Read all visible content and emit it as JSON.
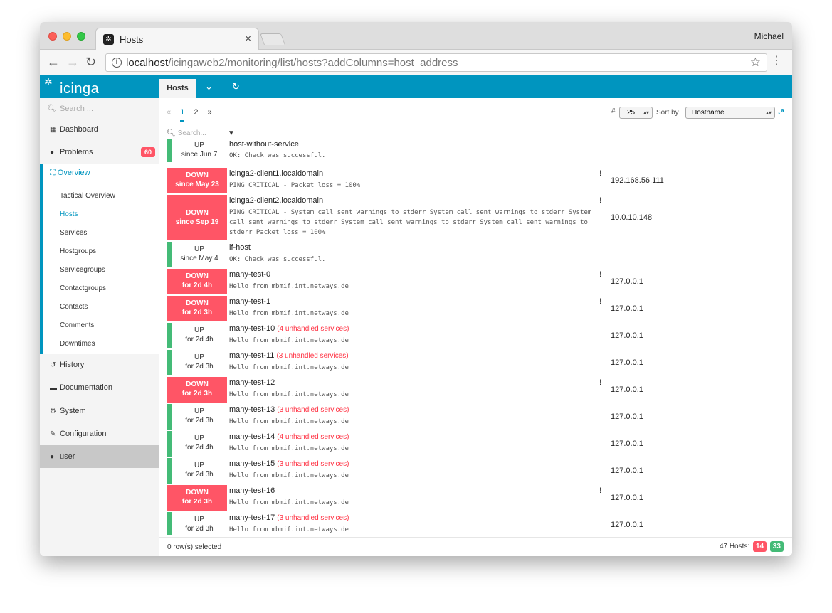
{
  "browser": {
    "tab_title": "Hosts",
    "tab_close": "×",
    "profile_name": "Michael",
    "url_host": "localhost",
    "url_path": "/icingaweb2/monitoring/list/hosts?addColumns=host_address"
  },
  "app": {
    "logo_text": "icinga",
    "content_tab": "Hosts"
  },
  "sidebar": {
    "search_placeholder": "Search ...",
    "dashboard": "Dashboard",
    "problems": "Problems",
    "problems_count": "60",
    "overview": "Overview",
    "overview_items": [
      "Tactical Overview",
      "Hosts",
      "Services",
      "Hostgroups",
      "Servicegroups",
      "Contactgroups",
      "Contacts",
      "Comments",
      "Downtimes"
    ],
    "history": "History",
    "documentation": "Documentation",
    "system": "System",
    "configuration": "Configuration",
    "user": "user"
  },
  "controls": {
    "page_first": "«",
    "page_1": "1",
    "page_2": "2",
    "page_next": "»",
    "limit_label": "#",
    "limit_value": "25",
    "sort_label": "Sort by",
    "sort_value": "Hostname",
    "search_placeholder": "Search..."
  },
  "hosts": [
    {
      "state": "UP",
      "since": "since Jun 7",
      "name": "host-without-service",
      "unhandled": "",
      "output": "OK: Check was successful.",
      "ack": "",
      "address": ""
    },
    {
      "state": "DOWN",
      "since": "since May 23",
      "name": "icinga2-client1.localdomain",
      "unhandled": "",
      "output": "PING CRITICAL - Packet loss = 100%",
      "ack": "!",
      "address": "192.168.56.111"
    },
    {
      "state": "DOWN",
      "since": "since Sep 19",
      "name": "icinga2-client2.localdomain",
      "unhandled": "",
      "output": "PING CRITICAL - System call sent warnings to stderr  System call sent warnings to stderr  System call sent warnings to stderr  System call sent warnings to stderr  System call sent warnings to stderr Packet loss = 100%",
      "ack": "!",
      "address": "10.0.10.148"
    },
    {
      "state": "UP",
      "since": "since May 4",
      "name": "if-host",
      "unhandled": "",
      "output": "OK: Check was successful.",
      "ack": "",
      "address": ""
    },
    {
      "state": "DOWN",
      "since": "for 2d 4h",
      "name": "many-test-0",
      "unhandled": "",
      "output": "Hello from mbmif.int.netways.de",
      "ack": "!",
      "address": "127.0.0.1"
    },
    {
      "state": "DOWN",
      "since": "for 2d 3h",
      "name": "many-test-1",
      "unhandled": "",
      "output": "Hello from mbmif.int.netways.de",
      "ack": "!",
      "address": "127.0.0.1"
    },
    {
      "state": "UP",
      "since": "for 2d 4h",
      "name": "many-test-10",
      "unhandled": "(4 unhandled services)",
      "output": "Hello from mbmif.int.netways.de",
      "ack": "",
      "address": "127.0.0.1"
    },
    {
      "state": "UP",
      "since": "for 2d 3h",
      "name": "many-test-11",
      "unhandled": "(3 unhandled services)",
      "output": "Hello from mbmif.int.netways.de",
      "ack": "",
      "address": "127.0.0.1"
    },
    {
      "state": "DOWN",
      "since": "for 2d 3h",
      "name": "many-test-12",
      "unhandled": "",
      "output": "Hello from mbmif.int.netways.de",
      "ack": "!",
      "address": "127.0.0.1"
    },
    {
      "state": "UP",
      "since": "for 2d 3h",
      "name": "many-test-13",
      "unhandled": "(3 unhandled services)",
      "output": "Hello from mbmif.int.netways.de",
      "ack": "",
      "address": "127.0.0.1"
    },
    {
      "state": "UP",
      "since": "for 2d 4h",
      "name": "many-test-14",
      "unhandled": "(4 unhandled services)",
      "output": "Hello from mbmif.int.netways.de",
      "ack": "",
      "address": "127.0.0.1"
    },
    {
      "state": "UP",
      "since": "for 2d 3h",
      "name": "many-test-15",
      "unhandled": "(3 unhandled services)",
      "output": "Hello from mbmif.int.netways.de",
      "ack": "",
      "address": "127.0.0.1"
    },
    {
      "state": "DOWN",
      "since": "for 2d 3h",
      "name": "many-test-16",
      "unhandled": "",
      "output": "Hello from mbmif.int.netways.de",
      "ack": "!",
      "address": "127.0.0.1"
    },
    {
      "state": "UP",
      "since": "for 2d 3h",
      "name": "many-test-17",
      "unhandled": "(3 unhandled services)",
      "output": "Hello from mbmif.int.netways.de",
      "ack": "",
      "address": "127.0.0.1"
    }
  ],
  "footer": {
    "selected": "0 row(s) selected",
    "hosts_total": "47 Hosts:",
    "hosts_down": "14",
    "hosts_up": "33"
  },
  "colors": {
    "brand": "#0095bf",
    "down": "#ff5566",
    "up": "#44bb77"
  }
}
